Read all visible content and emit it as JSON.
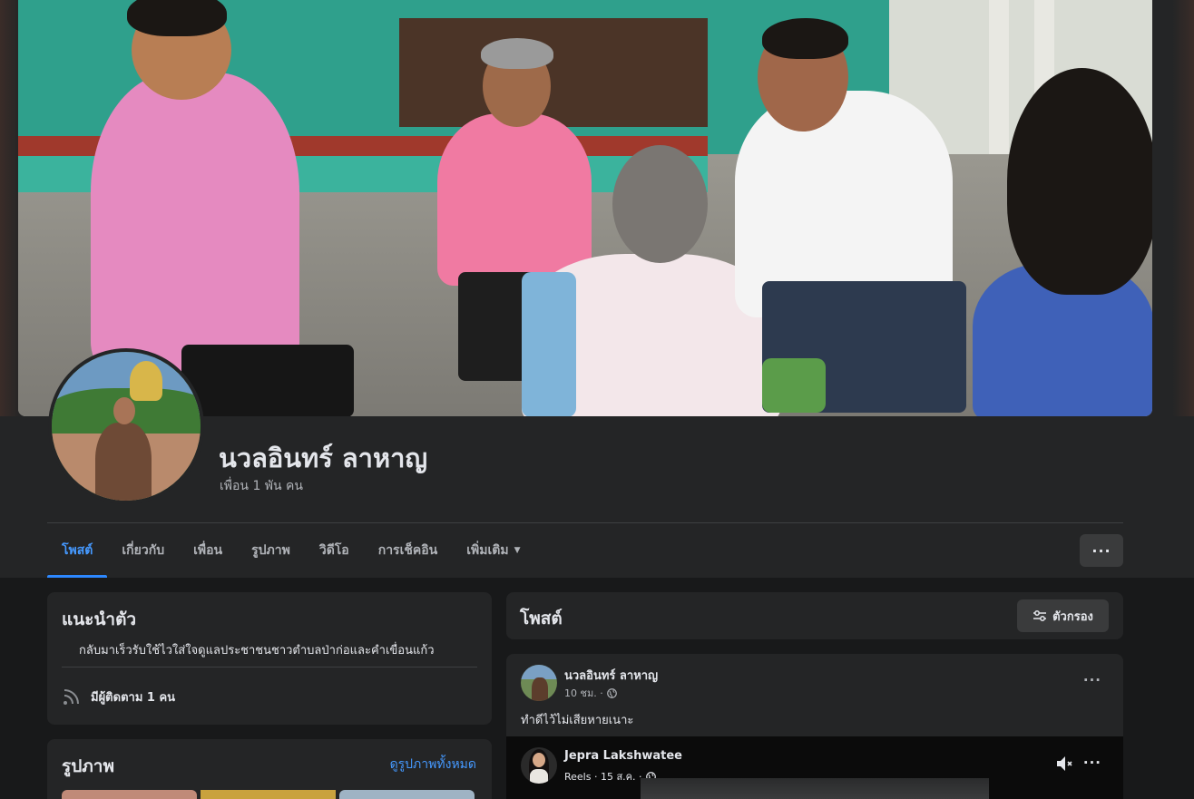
{
  "profile": {
    "name": "นวลอินทร์ ลาหาญ",
    "friends": "เพื่อน 1 พัน คน"
  },
  "tabs": [
    {
      "label": "โพสต์",
      "active": true
    },
    {
      "label": "เกี่ยวกับ",
      "active": false
    },
    {
      "label": "เพื่อน",
      "active": false
    },
    {
      "label": "รูปภาพ",
      "active": false
    },
    {
      "label": "วิดีโอ",
      "active": false
    },
    {
      "label": "การเช็คอิน",
      "active": false
    },
    {
      "label": "เพิ่มเติม",
      "active": false
    }
  ],
  "more_button": "···",
  "intro": {
    "title": "แนะนำตัว",
    "bio": "กลับมาเร็วรับใช้ไวใส่ใจดูแลประชาชนชาวตำบลป่าก่อและคำเขื่อนแก้ว",
    "followers": "มีผู้ติดตาม 1 คน",
    "icon": "rss-icon"
  },
  "photos": {
    "title": "รูปภาพ",
    "see_all": "ดูรูปภาพทั้งหมด"
  },
  "posts": {
    "title": "โพสต์",
    "filter_label": "ตัวกรอง",
    "items": [
      {
        "author": "นวลอินทร์ ลาหาญ",
        "time": "10 ชม. ·",
        "text": "ทำดีไว้ไม่เสียหายเนาะ",
        "more": "···",
        "shared": {
          "author": "Jepra Lakshwatee",
          "meta": "Reels · 15 ส.ค. ·",
          "more": "···"
        }
      }
    ]
  },
  "colors": {
    "accent": "#2d88ff",
    "card_bg": "#242526",
    "page_bg": "#18191a",
    "text_secondary": "#b0b3b8"
  }
}
